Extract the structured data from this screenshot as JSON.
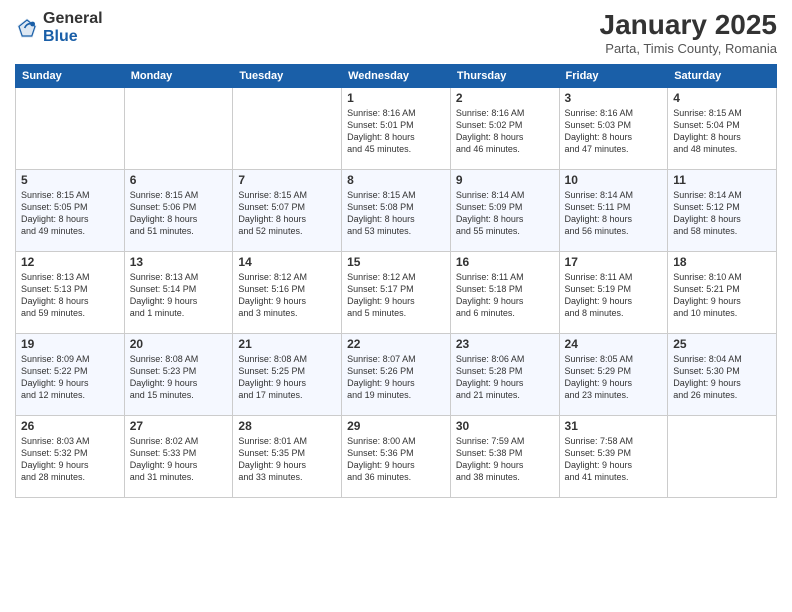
{
  "logo": {
    "general": "General",
    "blue": "Blue"
  },
  "header": {
    "title": "January 2025",
    "subtitle": "Parta, Timis County, Romania"
  },
  "days_of_week": [
    "Sunday",
    "Monday",
    "Tuesday",
    "Wednesday",
    "Thursday",
    "Friday",
    "Saturday"
  ],
  "weeks": [
    [
      {
        "day": "",
        "info": ""
      },
      {
        "day": "",
        "info": ""
      },
      {
        "day": "",
        "info": ""
      },
      {
        "day": "1",
        "info": "Sunrise: 8:16 AM\nSunset: 5:01 PM\nDaylight: 8 hours\nand 45 minutes."
      },
      {
        "day": "2",
        "info": "Sunrise: 8:16 AM\nSunset: 5:02 PM\nDaylight: 8 hours\nand 46 minutes."
      },
      {
        "day": "3",
        "info": "Sunrise: 8:16 AM\nSunset: 5:03 PM\nDaylight: 8 hours\nand 47 minutes."
      },
      {
        "day": "4",
        "info": "Sunrise: 8:15 AM\nSunset: 5:04 PM\nDaylight: 8 hours\nand 48 minutes."
      }
    ],
    [
      {
        "day": "5",
        "info": "Sunrise: 8:15 AM\nSunset: 5:05 PM\nDaylight: 8 hours\nand 49 minutes."
      },
      {
        "day": "6",
        "info": "Sunrise: 8:15 AM\nSunset: 5:06 PM\nDaylight: 8 hours\nand 51 minutes."
      },
      {
        "day": "7",
        "info": "Sunrise: 8:15 AM\nSunset: 5:07 PM\nDaylight: 8 hours\nand 52 minutes."
      },
      {
        "day": "8",
        "info": "Sunrise: 8:15 AM\nSunset: 5:08 PM\nDaylight: 8 hours\nand 53 minutes."
      },
      {
        "day": "9",
        "info": "Sunrise: 8:14 AM\nSunset: 5:09 PM\nDaylight: 8 hours\nand 55 minutes."
      },
      {
        "day": "10",
        "info": "Sunrise: 8:14 AM\nSunset: 5:11 PM\nDaylight: 8 hours\nand 56 minutes."
      },
      {
        "day": "11",
        "info": "Sunrise: 8:14 AM\nSunset: 5:12 PM\nDaylight: 8 hours\nand 58 minutes."
      }
    ],
    [
      {
        "day": "12",
        "info": "Sunrise: 8:13 AM\nSunset: 5:13 PM\nDaylight: 8 hours\nand 59 minutes."
      },
      {
        "day": "13",
        "info": "Sunrise: 8:13 AM\nSunset: 5:14 PM\nDaylight: 9 hours\nand 1 minute."
      },
      {
        "day": "14",
        "info": "Sunrise: 8:12 AM\nSunset: 5:16 PM\nDaylight: 9 hours\nand 3 minutes."
      },
      {
        "day": "15",
        "info": "Sunrise: 8:12 AM\nSunset: 5:17 PM\nDaylight: 9 hours\nand 5 minutes."
      },
      {
        "day": "16",
        "info": "Sunrise: 8:11 AM\nSunset: 5:18 PM\nDaylight: 9 hours\nand 6 minutes."
      },
      {
        "day": "17",
        "info": "Sunrise: 8:11 AM\nSunset: 5:19 PM\nDaylight: 9 hours\nand 8 minutes."
      },
      {
        "day": "18",
        "info": "Sunrise: 8:10 AM\nSunset: 5:21 PM\nDaylight: 9 hours\nand 10 minutes."
      }
    ],
    [
      {
        "day": "19",
        "info": "Sunrise: 8:09 AM\nSunset: 5:22 PM\nDaylight: 9 hours\nand 12 minutes."
      },
      {
        "day": "20",
        "info": "Sunrise: 8:08 AM\nSunset: 5:23 PM\nDaylight: 9 hours\nand 15 minutes."
      },
      {
        "day": "21",
        "info": "Sunrise: 8:08 AM\nSunset: 5:25 PM\nDaylight: 9 hours\nand 17 minutes."
      },
      {
        "day": "22",
        "info": "Sunrise: 8:07 AM\nSunset: 5:26 PM\nDaylight: 9 hours\nand 19 minutes."
      },
      {
        "day": "23",
        "info": "Sunrise: 8:06 AM\nSunset: 5:28 PM\nDaylight: 9 hours\nand 21 minutes."
      },
      {
        "day": "24",
        "info": "Sunrise: 8:05 AM\nSunset: 5:29 PM\nDaylight: 9 hours\nand 23 minutes."
      },
      {
        "day": "25",
        "info": "Sunrise: 8:04 AM\nSunset: 5:30 PM\nDaylight: 9 hours\nand 26 minutes."
      }
    ],
    [
      {
        "day": "26",
        "info": "Sunrise: 8:03 AM\nSunset: 5:32 PM\nDaylight: 9 hours\nand 28 minutes."
      },
      {
        "day": "27",
        "info": "Sunrise: 8:02 AM\nSunset: 5:33 PM\nDaylight: 9 hours\nand 31 minutes."
      },
      {
        "day": "28",
        "info": "Sunrise: 8:01 AM\nSunset: 5:35 PM\nDaylight: 9 hours\nand 33 minutes."
      },
      {
        "day": "29",
        "info": "Sunrise: 8:00 AM\nSunset: 5:36 PM\nDaylight: 9 hours\nand 36 minutes."
      },
      {
        "day": "30",
        "info": "Sunrise: 7:59 AM\nSunset: 5:38 PM\nDaylight: 9 hours\nand 38 minutes."
      },
      {
        "day": "31",
        "info": "Sunrise: 7:58 AM\nSunset: 5:39 PM\nDaylight: 9 hours\nand 41 minutes."
      },
      {
        "day": "",
        "info": ""
      }
    ]
  ]
}
